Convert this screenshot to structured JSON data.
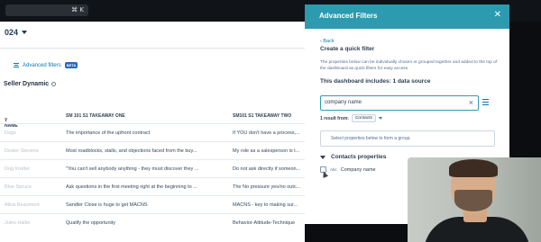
{
  "topbar": {
    "shortcut": "⌘ K"
  },
  "app": {
    "title": "024",
    "advanced_filters_label": "Advanced filters",
    "beta_badge": "BETA",
    "section_title": "Seller Dynamic",
    "columns": [
      "Y NAME",
      "SM 101 S1 TAKEAWAY ONE",
      "SM101 S1 TAKEAWAY TWO"
    ],
    "rows": [
      {
        "name": "Dogs",
        "one": "The importance of the upfront contract",
        "two": "If YOU don't have a process,..."
      },
      {
        "name": "Dealer Stevens",
        "one": "Most roadblocks, stalls, and objections faced from the buy...",
        "two": "My role as a salesperson is t..."
      },
      {
        "name": "Dog Insider",
        "one": "\"You can't sell anybody anything - they must discover they ...",
        "two": "Do not ask directly if someon..."
      },
      {
        "name": "Blue Spruce",
        "one": "Ask questions in the first meeting right at the beginning to ...",
        "two": "The No pressure yes/no outc..."
      },
      {
        "name": "Alina Beaumont",
        "one": "Sandler Close is huge to get MACNS",
        "two": "MACNS - key to making sur..."
      },
      {
        "name": "Jules Haller",
        "one": "Qualify the opportunity",
        "two": "Behavior-Attitude-Technique"
      }
    ]
  },
  "panel": {
    "title": "Advanced Filters",
    "back": "Back",
    "heading": "Create a quick filter",
    "description": "The properties below can be individually chosen or grouped together and added to the top of the dashboard as quick filters for easy access.",
    "data_sources": "This dashboard includes: 1 data source",
    "search_value": "company name",
    "result_prefix": "1 result from:",
    "result_chip": "Contacts",
    "placeholder": "Select properties below to form a group.",
    "group_label": "Contacts properties",
    "property_label": "Company name",
    "property_type_icon": "Abc"
  },
  "colors": {
    "panel_header": "#2c9bb0",
    "link": "#0b79a8",
    "text": "#2d3e50"
  }
}
